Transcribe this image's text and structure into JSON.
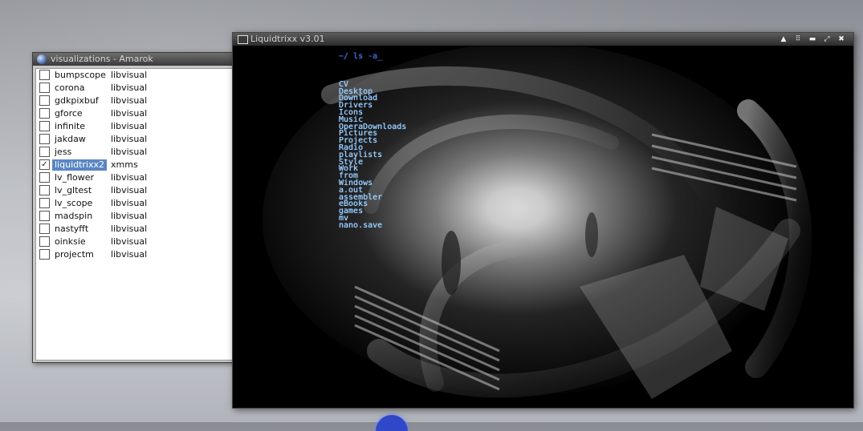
{
  "amarok": {
    "title": "visualizations - Amarok",
    "items": [
      {
        "name": "bumpscope",
        "plugin": "libvisual",
        "checked": false
      },
      {
        "name": "corona",
        "plugin": "libvisual",
        "checked": false
      },
      {
        "name": "gdkpixbuf",
        "plugin": "libvisual",
        "checked": false
      },
      {
        "name": "gforce",
        "plugin": "libvisual",
        "checked": false
      },
      {
        "name": "infinite",
        "plugin": "libvisual",
        "checked": false
      },
      {
        "name": "jakdaw",
        "plugin": "libvisual",
        "checked": false
      },
      {
        "name": "jess",
        "plugin": "libvisual",
        "checked": false
      },
      {
        "name": "liquidtrixx2",
        "plugin": "xmms",
        "checked": true,
        "check_glyph": "✓"
      },
      {
        "name": "lv_flower",
        "plugin": "libvisual",
        "checked": false
      },
      {
        "name": "lv_gltest",
        "plugin": "libvisual",
        "checked": false
      },
      {
        "name": "lv_scope",
        "plugin": "libvisual",
        "checked": false
      },
      {
        "name": "madspin",
        "plugin": "libvisual",
        "checked": false
      },
      {
        "name": "nastyfft",
        "plugin": "libvisual",
        "checked": false
      },
      {
        "name": "oinksie",
        "plugin": "libvisual",
        "checked": false
      },
      {
        "name": "projectm",
        "plugin": "libvisual",
        "checked": false
      }
    ]
  },
  "visualizer": {
    "title": "Liquidtrixx v3.01",
    "buttons": [
      {
        "name": "shade-button",
        "glyph": "▲"
      },
      {
        "name": "sticky-button",
        "glyph": "⠿"
      },
      {
        "name": "minimize-button",
        "glyph": "▬"
      },
      {
        "name": "maximize-button",
        "glyph": "⤢"
      },
      {
        "name": "close-button",
        "glyph": "✖"
      }
    ],
    "terminal": {
      "prompt": "~/ ls -a_",
      "entries": [
        "CV",
        "Desktop",
        "Download",
        "Drivers",
        "Icons",
        "Music",
        "OperaDownloads",
        "Pictures",
        "Projects",
        "Radio",
        "playlists",
        "Style",
        "Work",
        "from",
        "Windows",
        "a.out",
        "assembler",
        "eBooks",
        "games",
        "mv",
        "nano.save"
      ]
    }
  },
  "colors": {
    "selection": "#5a87c4",
    "terminal_text": "#a8d8ff",
    "prompt_text": "#3a52d8"
  }
}
